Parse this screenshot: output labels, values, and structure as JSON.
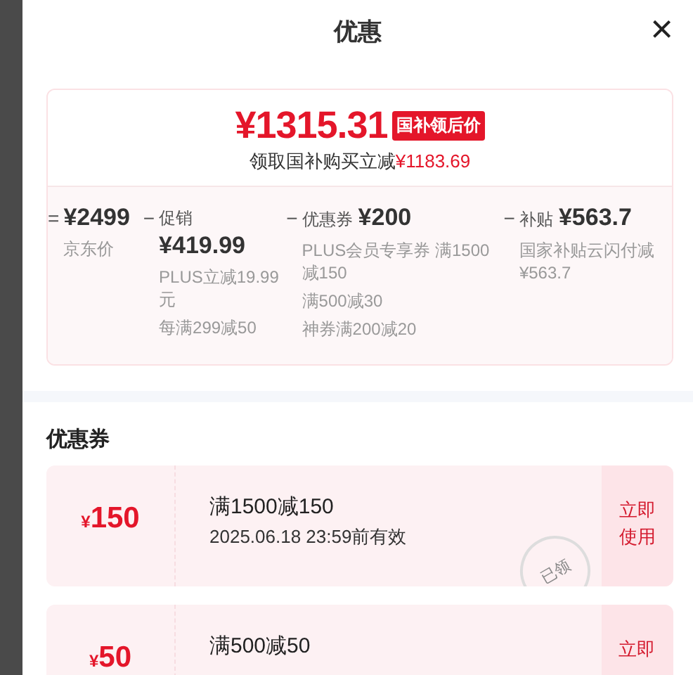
{
  "sheet": {
    "title": "优惠",
    "close": "×"
  },
  "summary": {
    "price": "¥1315.31",
    "badge": "国补领后价",
    "subline": "领取国补购买立减",
    "subline_amount": "¥1183.69",
    "breakdown": [
      {
        "kind": "base",
        "operator": "=",
        "amount": "¥2499",
        "label": "京东价"
      },
      {
        "kind": "stacked",
        "operator": "−",
        "label": "促销",
        "amount": "¥419.99",
        "notes": [
          "PLUS立减19.99元",
          "每满299减50"
        ]
      },
      {
        "kind": "inline",
        "operator": "−",
        "label": "优惠券",
        "amount": "¥200",
        "notes": [
          "PLUS会员专享券 满1500减150",
          "满500减30",
          "神券满200减20"
        ]
      },
      {
        "kind": "inline",
        "operator": "−",
        "label": "补贴",
        "amount": "¥563.7",
        "notes": [
          "国家补贴云闪付减¥563.7"
        ]
      }
    ]
  },
  "coupons_section": {
    "title": "优惠券",
    "coupons": [
      {
        "currency": "¥",
        "amount": "150",
        "title": "满1500减150",
        "validity": "2025.06.18 23:59前有效",
        "action": "立即使用",
        "claimed": true,
        "stamp": "已领"
      },
      {
        "currency": "¥",
        "amount": "50",
        "title": "满500减50",
        "action": "立即"
      }
    ]
  }
}
